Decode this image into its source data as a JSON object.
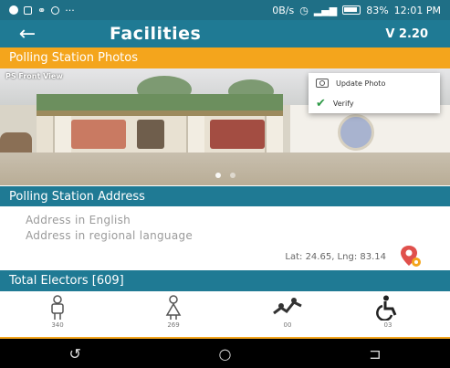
{
  "status_bar": {
    "left_text": "···",
    "speed": "0B/s",
    "battery": "83%",
    "time": "12:01 PM"
  },
  "app_bar": {
    "title": "Facilities",
    "version": "V 2.20"
  },
  "photos_section": {
    "title": "Polling Station Photos",
    "caption": "PS Front View",
    "active_page": 1,
    "pages": 2
  },
  "photo_menu": {
    "update_label": "Update Photo",
    "verify_label": "Verify"
  },
  "address_section": {
    "title": "Polling Station Address",
    "address_english": "Address in English",
    "address_regional": "Address in regional language",
    "latlng": "Lat: 24.65, Lng: 83.14"
  },
  "electors_section": {
    "title": "Total Electors [609]",
    "groups": [
      {
        "icon": "male-icon",
        "count": "340"
      },
      {
        "icon": "female-icon",
        "count": "269"
      },
      {
        "icon": "third-gender-icon",
        "count": "00"
      },
      {
        "icon": "disabled-icon",
        "count": "03"
      }
    ]
  },
  "nav_bar": {
    "back_glyph": "↺",
    "home_glyph": "○",
    "recent_glyph": "⊐"
  },
  "colors": {
    "primary": "#1f7a94",
    "accent": "#f4a51c"
  }
}
